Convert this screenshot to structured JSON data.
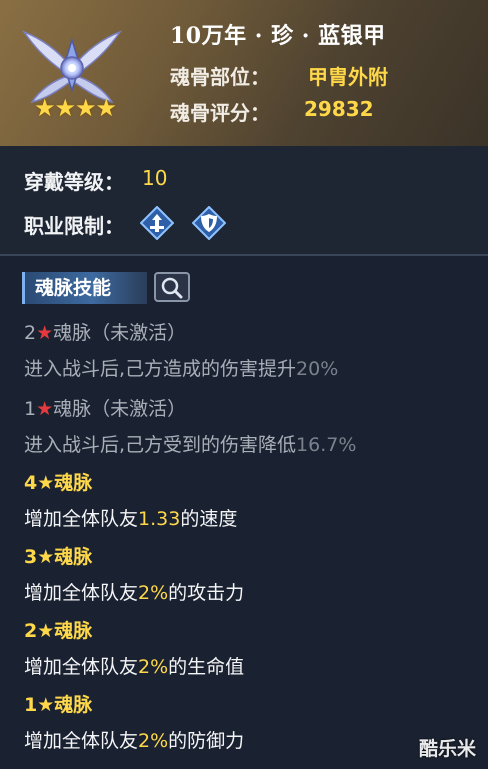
{
  "header": {
    "title": "10万年 · 珍 · 蓝银甲",
    "slot_label": "魂骨部位：",
    "slot_value": "甲胄外附",
    "score_label": "魂骨评分：",
    "score_value": "29832",
    "stars": "★★★★"
  },
  "info": {
    "wear_label": "穿戴等级：",
    "wear_value": "10",
    "job_label": "职业限制："
  },
  "tabs": {
    "skill_tab": "魂脉技能"
  },
  "skills": [
    {
      "level": "2",
      "star": "★",
      "name": "魂脉（未激活）",
      "desc_prefix": "进入战斗后,己方造成的伤害提升",
      "desc_value": "20%",
      "desc_suffix": ""
    },
    {
      "level": "1",
      "star": "★",
      "name": "魂脉（未激活）",
      "desc_prefix": "进入战斗后,己方受到的伤害降低",
      "desc_value": "16.7%",
      "desc_suffix": ""
    },
    {
      "level": "4",
      "star": "★",
      "name": "魂脉",
      "desc_prefix": "增加全体队友",
      "desc_value": "1.33",
      "desc_suffix": "的速度"
    },
    {
      "level": "3",
      "star": "★",
      "name": "魂脉",
      "desc_prefix": "增加全体队友",
      "desc_value": "2%",
      "desc_suffix": "的攻击力"
    },
    {
      "level": "2",
      "star": "★",
      "name": "魂脉",
      "desc_prefix": "增加全体队友",
      "desc_value": "2%",
      "desc_suffix": "的生命值"
    },
    {
      "level": "1",
      "star": "★",
      "name": "魂脉",
      "desc_prefix": "增加全体队友",
      "desc_value": "2%",
      "desc_suffix": "的防御力"
    }
  ],
  "watermark": "酷乐米",
  "icons": [
    "bone-armor-emblem-icon",
    "class-attack-icon",
    "class-defense-icon",
    "search-icon"
  ],
  "colors": {
    "gold": "#ffd84a",
    "red_star": "#e5393e",
    "dim_text": "#a9afb9",
    "tab_blue": "#3d6aa0"
  }
}
